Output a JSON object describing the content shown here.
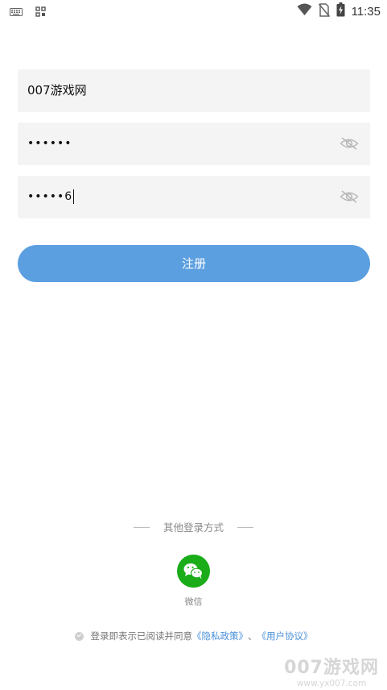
{
  "status_bar": {
    "time": "11:35",
    "icons": [
      "keyboard-icon",
      "grid-icon",
      "wifi-icon",
      "no-sim-icon",
      "battery-charging-icon"
    ]
  },
  "form": {
    "username_value": "007游戏网",
    "password_value": "••••••",
    "confirm_password_value": "•••••6",
    "eye_icon": "eye-off-icon"
  },
  "register_button": {
    "label": "注册",
    "color": "#5b9fe0"
  },
  "other_login": {
    "label": "其他登录方式",
    "wechat_label": "微信",
    "wechat_color": "#1aad19"
  },
  "agreement": {
    "prefix": "登录即表示已阅读并同意",
    "privacy_link": "《隐私政策》",
    "separator": "、",
    "user_agreement_link": "《用户协议》"
  },
  "watermark": {
    "main": "007游戏网",
    "sub": "www.yx007.com"
  }
}
